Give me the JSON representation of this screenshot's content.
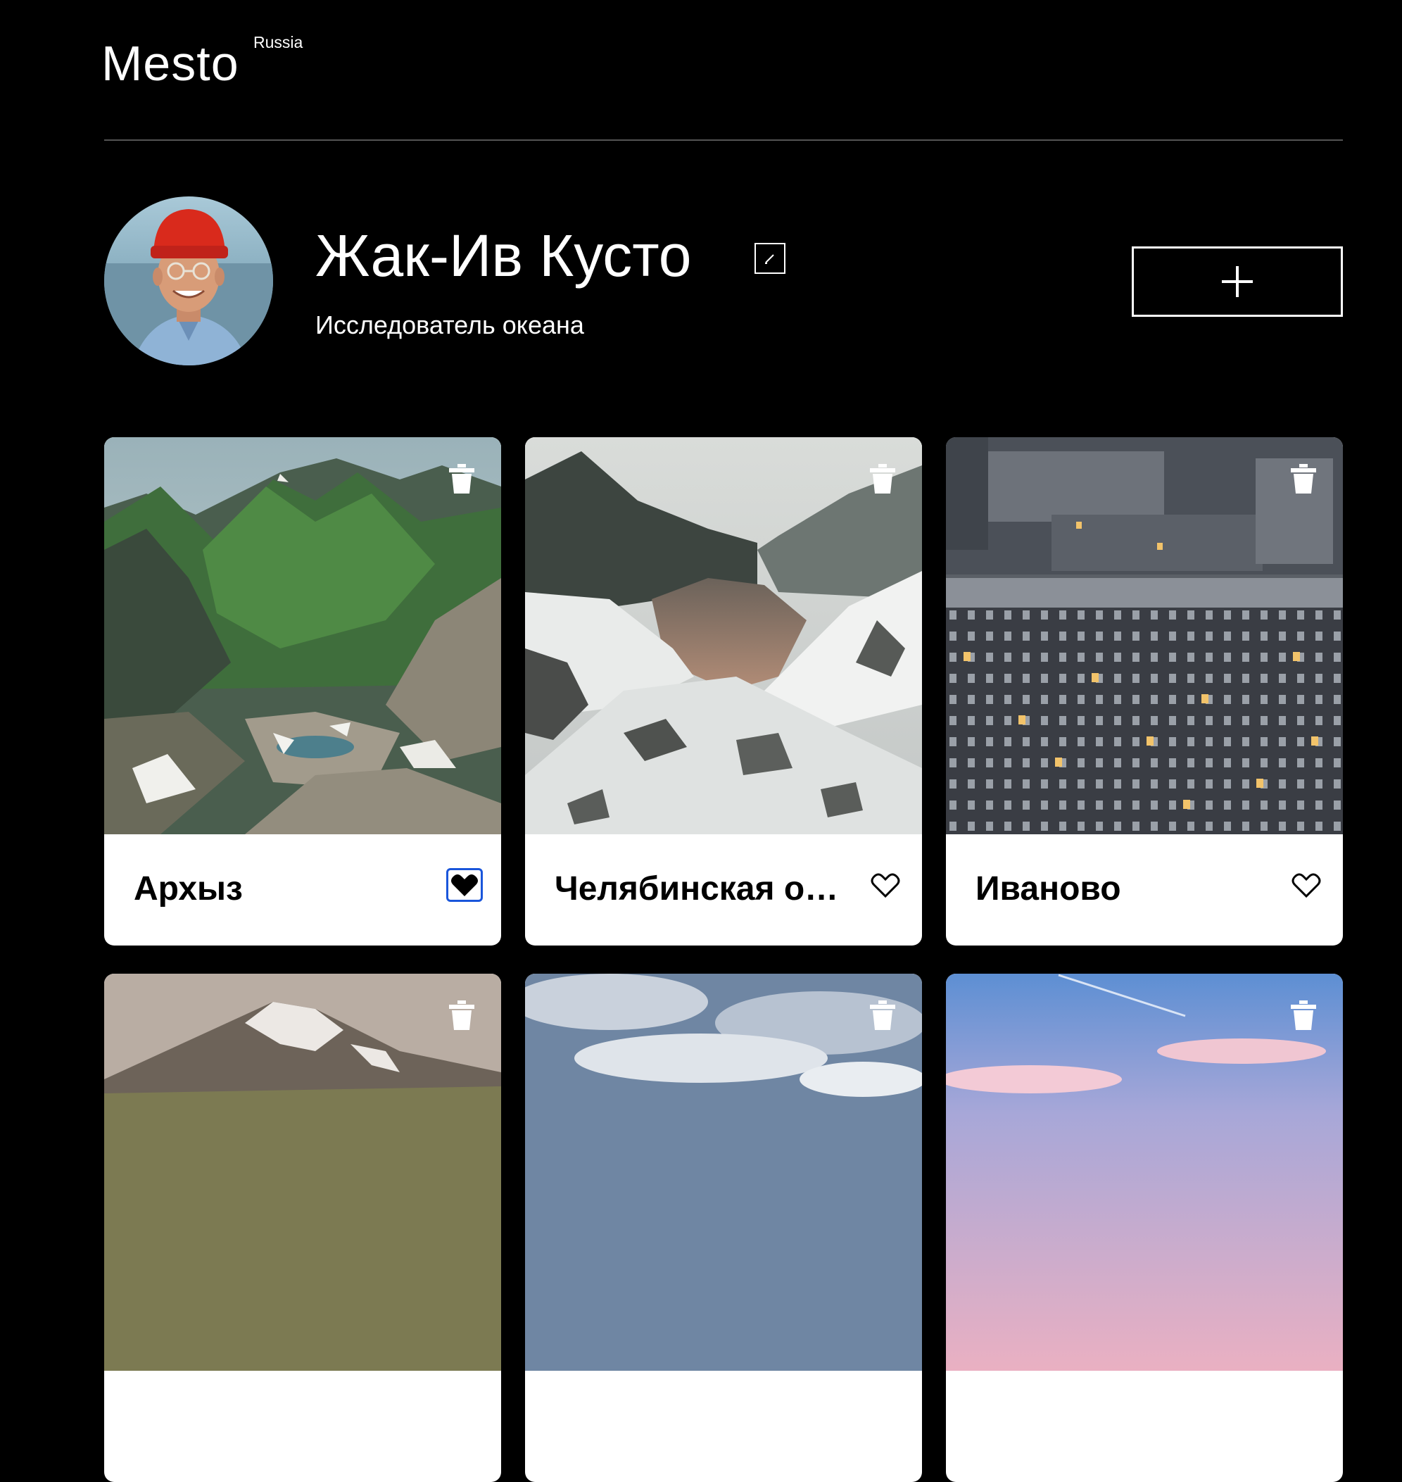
{
  "header": {
    "logo": "Mesto",
    "logo_suffix": "Russia"
  },
  "profile": {
    "name": "Жак-Ив Кусто",
    "about": "Исследователь океана"
  },
  "cards": [
    {
      "title": "Архыз",
      "liked": true,
      "scene": "mountains"
    },
    {
      "title": "Челябинская область",
      "liked": false,
      "scene": "river-snow"
    },
    {
      "title": "Иваново",
      "liked": false,
      "scene": "apartments"
    },
    {
      "title": "",
      "liked": false,
      "scene": "volcano"
    },
    {
      "title": "",
      "liked": false,
      "scene": "cloudy-sky"
    },
    {
      "title": "",
      "liked": false,
      "scene": "pink-sky"
    }
  ],
  "colors": {
    "background": "#000000",
    "card": "#ffffff",
    "divider": "#545454",
    "focus_outline": "#1a56db"
  }
}
